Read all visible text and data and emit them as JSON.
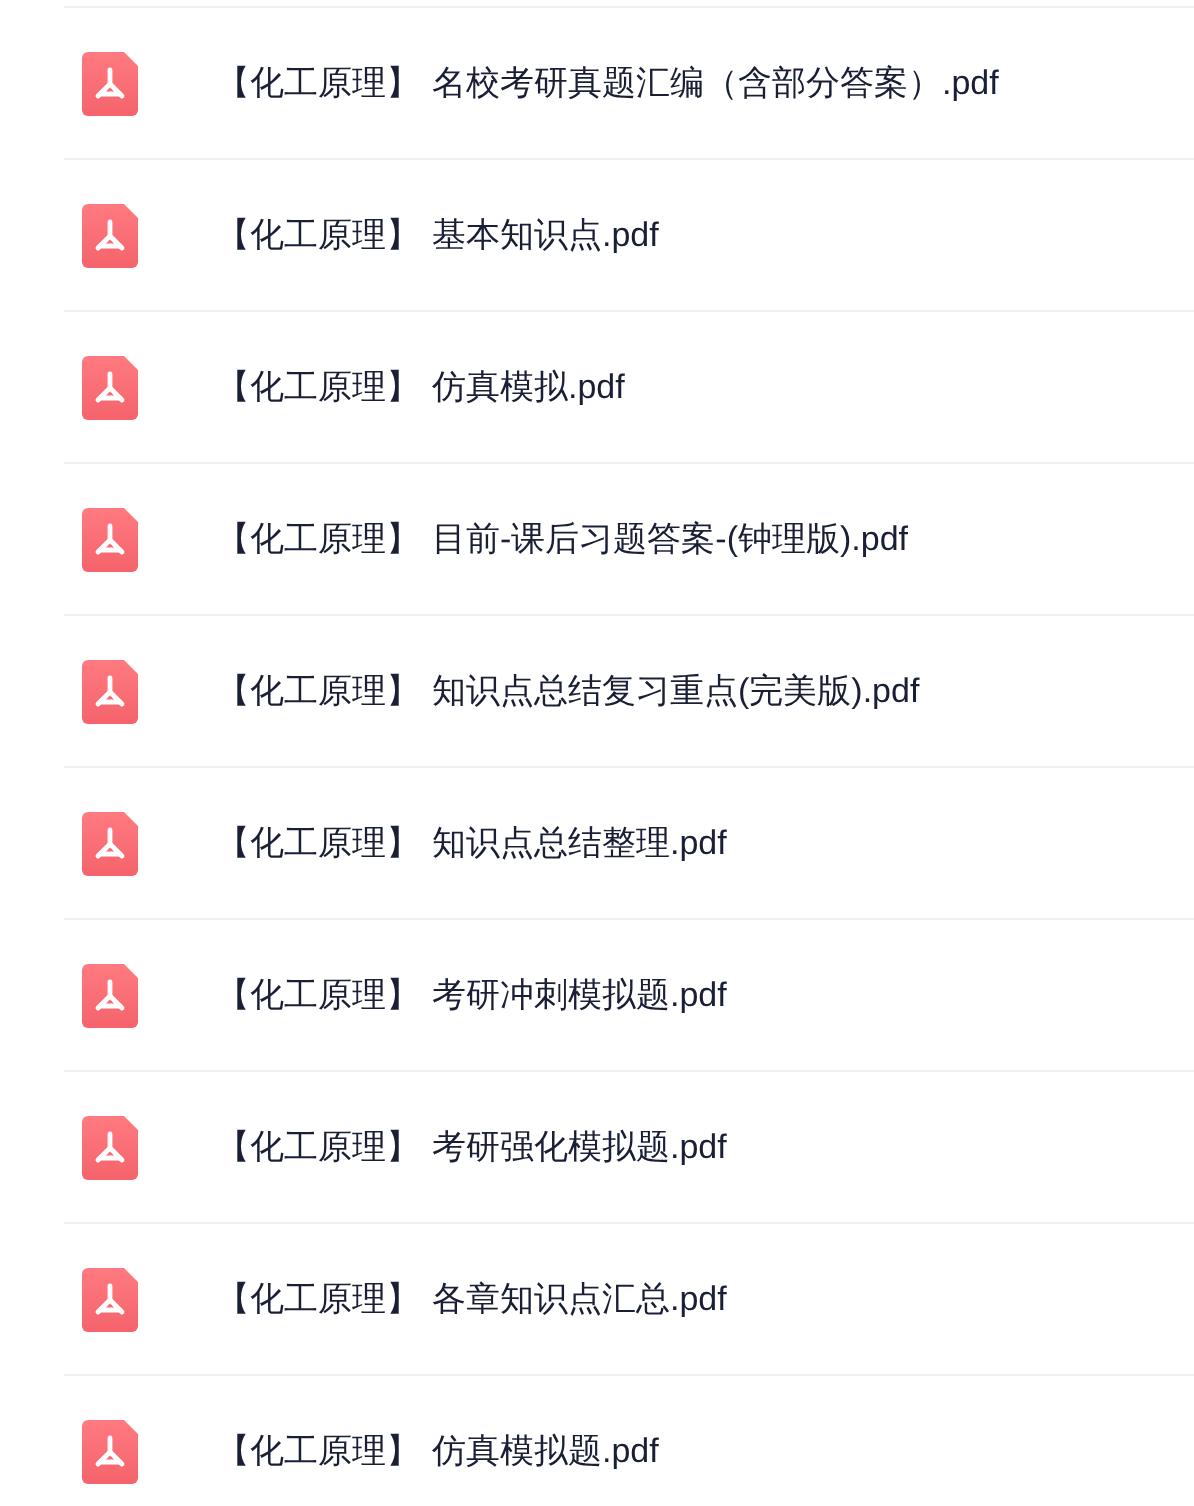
{
  "files": [
    {
      "category": "【化工原理】",
      "name": "名校考研真题汇编（含部分答案）.pdf"
    },
    {
      "category": "【化工原理】",
      "name": "基本知识点.pdf"
    },
    {
      "category": "【化工原理】",
      "name": "仿真模拟.pdf"
    },
    {
      "category": "【化工原理】",
      "name": "目前-课后习题答案-(钟理版).pdf"
    },
    {
      "category": "【化工原理】",
      "name": "知识点总结复习重点(完美版).pdf"
    },
    {
      "category": "【化工原理】",
      "name": "知识点总结整理.pdf"
    },
    {
      "category": "【化工原理】",
      "name": "考研冲刺模拟题.pdf"
    },
    {
      "category": "【化工原理】",
      "name": "考研强化模拟题.pdf"
    },
    {
      "category": "【化工原理】",
      "name": "各章知识点汇总.pdf"
    },
    {
      "category": "【化工原理】",
      "name": "仿真模拟题.pdf"
    }
  ]
}
